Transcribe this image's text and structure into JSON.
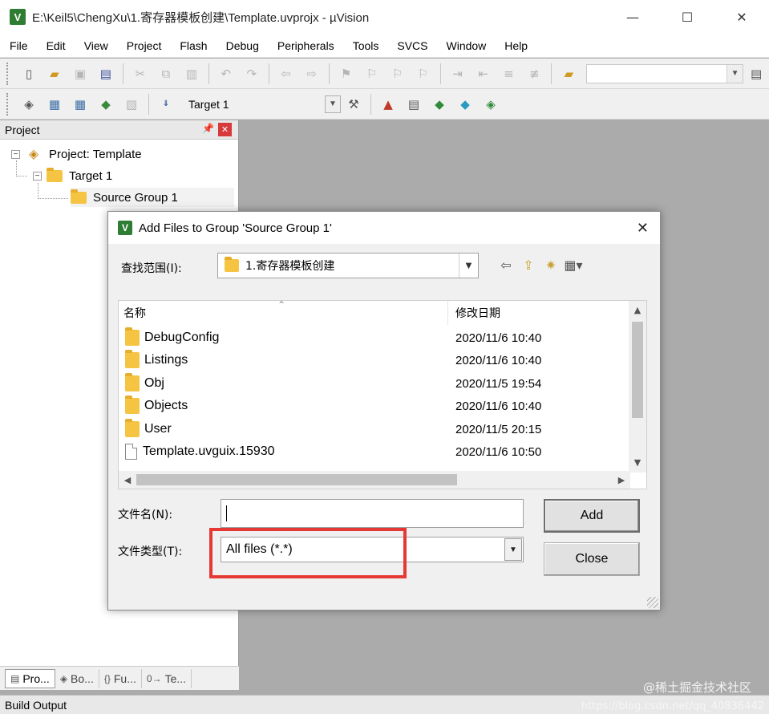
{
  "window": {
    "title": "E:\\Keil5\\ChengXu\\1.寄存器模板创建\\Template.uvprojx - µVision",
    "app_icon": "V",
    "controls": {
      "minimize": "—",
      "maximize": "☐",
      "close": "✕"
    }
  },
  "menu": [
    "File",
    "Edit",
    "View",
    "Project",
    "Flash",
    "Debug",
    "Peripherals",
    "Tools",
    "SVCS",
    "Window",
    "Help"
  ],
  "toolbar2": {
    "target_combo": "Target 1"
  },
  "project_pane": {
    "title": "Project",
    "tree": {
      "project": "Project: Template",
      "target": "Target 1",
      "group": "Source Group 1"
    },
    "tabs": [
      "Pro...",
      "Bo...",
      "Fu...",
      "Te..."
    ]
  },
  "build_output": {
    "label": "Build Output"
  },
  "watermark": {
    "text": "@稀土掘金技术社区",
    "url": "https://blog.csdn.net/qq_40836442"
  },
  "dialog": {
    "title": "Add Files to Group 'Source Group 1'",
    "app_icon": "V",
    "look_in_label": "查找范围(I):",
    "look_in_value": "1.寄存器模板创建",
    "columns": {
      "name": "名称",
      "date": "修改日期"
    },
    "files": [
      {
        "name": "DebugConfig",
        "date": "2020/11/6 10:40",
        "type": "folder"
      },
      {
        "name": "Listings",
        "date": "2020/11/6 10:40",
        "type": "folder"
      },
      {
        "name": "Obj",
        "date": "2020/11/5 19:54",
        "type": "folder"
      },
      {
        "name": "Objects",
        "date": "2020/11/6 10:40",
        "type": "folder"
      },
      {
        "name": "User",
        "date": "2020/11/5 20:15",
        "type": "folder"
      },
      {
        "name": "Template.uvguix.15930",
        "date": "2020/11/6 10:50",
        "type": "file"
      }
    ],
    "filename_label": "文件名(N):",
    "filename_value": "",
    "filetype_label": "文件类型(T):",
    "filetype_value": "All files (*.*)",
    "add_button": "Add",
    "close_button": "Close",
    "highlight_color": "#e53935"
  }
}
